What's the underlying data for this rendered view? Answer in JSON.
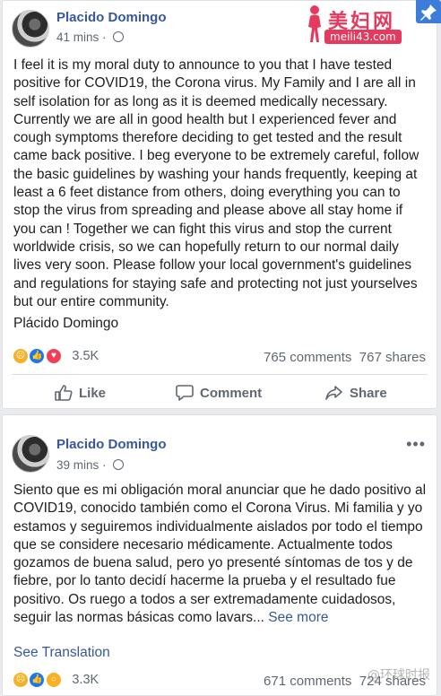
{
  "posts": [
    {
      "author": "Placido Domingo",
      "time": "41 mins",
      "time_separator": "·",
      "body": "I feel it is my moral duty to announce to you that I have tested positive for COVID19, the Corona virus. My Family and I are all in self isolation for as long as it is deemed medically necessary. Currently we are all in good health but I experienced fever and cough symptoms therefore deciding to get tested and the result came back positive. I beg everyone to be extremely careful, follow the basic guidelines by washing your hands frequently, keeping at least a 6 feet distance from others, doing everything you can to stop the virus from spreading and please above all stay home if you can ! Together we can fight this virus and stop the current worldwide crisis, so we can hopefully return to our normal daily lives very soon. Please follow your local government's guidelines and regulations for staying safe and protecting not just yourselves but our entire community.",
      "signature": "Plácido Domingo",
      "reaction_icons": [
        "sad",
        "like",
        "love"
      ],
      "reactions_count": "3.5K",
      "comments": "765 comments",
      "shares": "767 shares",
      "actions": {
        "like": "Like",
        "comment": "Comment",
        "share": "Share"
      }
    },
    {
      "author": "Placido Domingo",
      "time": "39 mins",
      "time_separator": "·",
      "body": "Siento que es mi obligación moral anunciar que he dado positivo al COVID19, conocido también como el Corona Virus. Mi familia y yo estamos y seguiremos individualmente aislados por todo el tiempo que se considere necesario médicamente. Actualmente todos gozamos de buena salud, pero yo presenté síntomas de tos y de fiebre, por lo tanto decidí hacerme la prueba y el resultado fue positivo. Os ruego a todos a ser extremadamente cuidadosos, seguir las normas básicas como lavars...",
      "see_more": "See more",
      "see_translation": "See Translation",
      "reaction_icons": [
        "sad",
        "like",
        "wow"
      ],
      "reactions_count": "3.3K",
      "comments": "671 comments",
      "shares": "724 shares"
    }
  ],
  "watermark": {
    "title": "美妇网",
    "site": "meili43.com",
    "weibo": "@环球时报"
  },
  "colors": {
    "link": "#385898",
    "muted": "#606770",
    "text": "#1c1e21",
    "background": "#e9ebee",
    "watermark": "#e5395e"
  }
}
